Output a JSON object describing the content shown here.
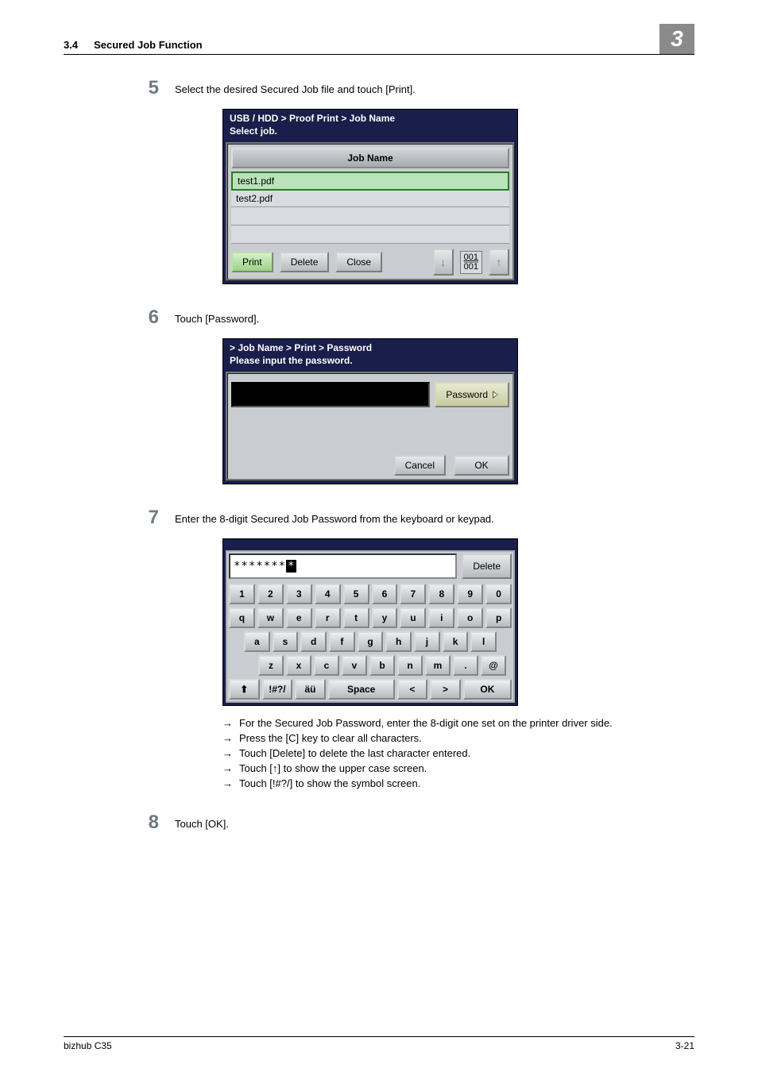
{
  "header": {
    "section_number": "3.4",
    "section_title": "Secured Job Function",
    "chapter": "3"
  },
  "step5": {
    "num": "5",
    "text": "Select the desired Secured Job file and touch [Print].",
    "panel": {
      "breadcrumb": "USB / HDD > Proof Print > Job Name",
      "title": "Select job.",
      "col_header": "Job Name",
      "rows": [
        "test1.pdf",
        "test2.pdf"
      ],
      "btn_print": "Print",
      "btn_delete": "Delete",
      "btn_close": "Close",
      "page_current": "001",
      "page_total": "001"
    }
  },
  "step6": {
    "num": "6",
    "text": "Touch [Password].",
    "panel": {
      "breadcrumb": "> Job Name > Print > Password",
      "title": "Please input the password.",
      "btn_password": "Password",
      "btn_cancel": "Cancel",
      "btn_ok": "OK"
    }
  },
  "step7": {
    "num": "7",
    "text": "Enter the 8-digit Secured Job Password from the keyboard or keypad.",
    "kbd": {
      "masked": "*******",
      "btn_delete": "Delete",
      "row_num": [
        "1",
        "2",
        "3",
        "4",
        "5",
        "6",
        "7",
        "8",
        "9",
        "0"
      ],
      "row_q": [
        "q",
        "w",
        "e",
        "r",
        "t",
        "y",
        "u",
        "i",
        "o",
        "p"
      ],
      "row_a": [
        "a",
        "s",
        "d",
        "f",
        "g",
        "h",
        "j",
        "k",
        "l"
      ],
      "row_z": [
        "z",
        "x",
        "c",
        "v",
        "b",
        "n",
        "m",
        ".",
        "@"
      ],
      "row_bottom": {
        "shift_icon": "↑",
        "sym": "!#?/",
        "accent": "äü",
        "space": "Space",
        "lt": "<",
        "gt": ">",
        "ok": "OK"
      }
    },
    "bullets": [
      "For the Secured Job Password, enter the 8-digit one set on the printer driver side.",
      "Press the [C] key to clear all characters.",
      "Touch [Delete] to delete the last character entered.",
      "Touch [↑] to show the upper case screen.",
      "Touch [!#?/] to show the symbol screen."
    ]
  },
  "step8": {
    "num": "8",
    "text": "Touch [OK]."
  },
  "footer": {
    "left": "bizhub C35",
    "right": "3-21"
  }
}
